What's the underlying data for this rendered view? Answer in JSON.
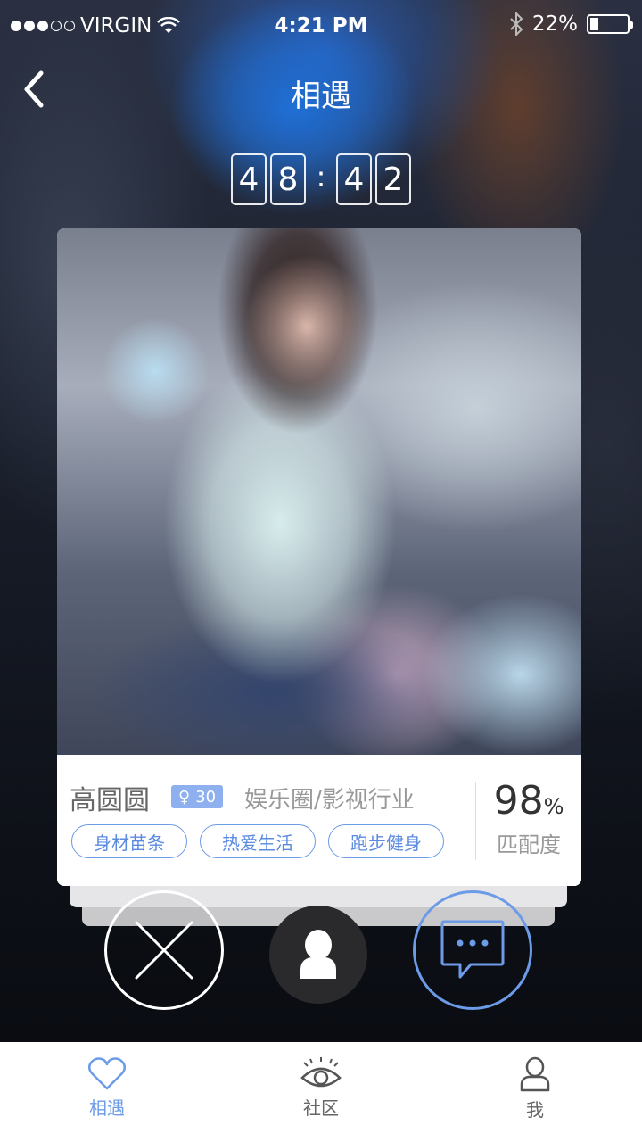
{
  "status_bar": {
    "carrier": "VIRGIN",
    "time": "4:21 PM",
    "battery_percent": "22%",
    "battery_level": 0.22,
    "signal_bars_filled": 3,
    "signal_bars_total": 5
  },
  "navbar": {
    "title": "相遇",
    "back_icon": "chevron-left-icon"
  },
  "countdown": {
    "digits": [
      "4",
      "8",
      "4",
      "2"
    ],
    "separator": ":"
  },
  "profile": {
    "name": "高圆圆",
    "gender_symbol": "♀",
    "age": "30",
    "industry": "娱乐圈/影视行业",
    "tags": [
      "身材苗条",
      "热爱生活",
      "跑步健身"
    ],
    "match_value": "98",
    "match_unit": "%",
    "match_label": "匹配度"
  },
  "actions": {
    "reject_icon": "close-icon",
    "profile_icon": "user-icon",
    "chat_icon": "chat-bubble-icon"
  },
  "tabbar": {
    "items": [
      {
        "label": "相遇",
        "icon": "heart-icon",
        "active": true
      },
      {
        "label": "社区",
        "icon": "eye-icon",
        "active": false
      },
      {
        "label": "我",
        "icon": "user-icon",
        "active": false
      }
    ]
  },
  "colors": {
    "accent": "#6c9be8",
    "badge": "#8fb0ef",
    "text_dark": "#333333",
    "text_muted": "#999999"
  }
}
